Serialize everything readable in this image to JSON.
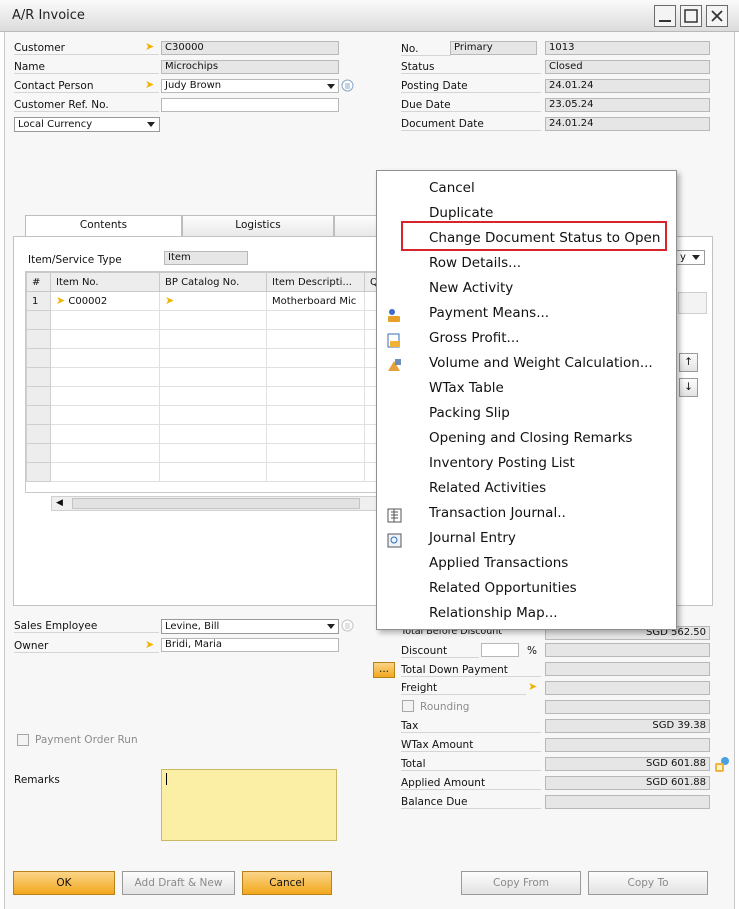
{
  "window": {
    "title": "A/R Invoice"
  },
  "header_left": {
    "customer_label": "Customer",
    "customer_value": "C30000",
    "name_label": "Name",
    "name_value": "Microchips",
    "contact_label": "Contact Person",
    "contact_value": "Judy Brown",
    "ref_label": "Customer Ref. No.",
    "ref_value": "",
    "currency_value": "Local Currency"
  },
  "header_right": {
    "no_label": "No.",
    "series_value": "Primary",
    "no_value": "1013",
    "status_label": "Status",
    "status_value": "Closed",
    "posting_label": "Posting Date",
    "posting_value": "24.01.24",
    "due_label": "Due Date",
    "due_value": "23.05.24",
    "document_label": "Document Date",
    "document_value": "24.01.24"
  },
  "tabs": [
    {
      "label": "Contents"
    },
    {
      "label": "Logistics"
    }
  ],
  "contents": {
    "type_label": "Item/Service Type",
    "type_value": "Item",
    "columns": [
      "#",
      "Item No.",
      "BP Catalog No.",
      "Item Descripti...",
      "Q"
    ],
    "rows": [
      {
        "num": "1",
        "item_no": "C00002",
        "bp_catalog": "",
        "description": "Motherboard Mic"
      }
    ],
    "right_combo_char": "y"
  },
  "context_menu": {
    "items": [
      {
        "label": "Cancel"
      },
      {
        "label": "Duplicate"
      },
      {
        "label": "Change Document Status to Open"
      },
      {
        "label": "Row Details..."
      },
      {
        "label": "New Activity"
      },
      {
        "label": "Payment Means..."
      },
      {
        "label": "Gross Profit..."
      },
      {
        "label": "Volume and Weight Calculation..."
      },
      {
        "label": "WTax Table"
      },
      {
        "label": "Packing Slip"
      },
      {
        "label": "Opening and Closing Remarks"
      },
      {
        "label": "Inventory Posting List"
      },
      {
        "label": "Related Activities"
      },
      {
        "label": "Transaction Journal.."
      },
      {
        "label": "Journal Entry"
      },
      {
        "label": "Applied Transactions"
      },
      {
        "label": "Related Opportunities"
      },
      {
        "label": "Relationship Map..."
      }
    ]
  },
  "footer_left": {
    "sales_employee_label": "Sales Employee",
    "sales_employee_value": "Levine, Bill",
    "owner_label": "Owner",
    "owner_value": "Bridi, Maria",
    "payment_order_label": "Payment Order Run",
    "remarks_label": "Remarks"
  },
  "totals": {
    "before_discount_label": "Total Before Discount",
    "before_discount_value": "SGD 562.50",
    "discount_label": "Discount",
    "percent_symbol": "%",
    "down_payment_label": "Total Down Payment",
    "freight_label": "Freight",
    "rounding_label": "Rounding",
    "tax_label": "Tax",
    "tax_value": "SGD 39.38",
    "wtax_label": "WTax Amount",
    "total_label": "Total",
    "total_value": "SGD 601.88",
    "applied_label": "Applied Amount",
    "applied_value": "SGD 601.88",
    "balance_label": "Balance Due"
  },
  "buttons": {
    "ok": "OK",
    "add_draft": "Add Draft & New",
    "cancel": "Cancel",
    "copy_from": "Copy From",
    "copy_to": "Copy To"
  },
  "icons": [
    "link-arrow-icon",
    "dropdown-icon",
    "contact-info-icon",
    "payment-means-icon",
    "gross-profit-icon",
    "volume-weight-icon",
    "transaction-journal-icon",
    "journal-entry-icon",
    "scroll-up-icon",
    "scroll-down-icon",
    "coins-icon",
    "minimize-icon",
    "maximize-icon",
    "close-icon"
  ]
}
